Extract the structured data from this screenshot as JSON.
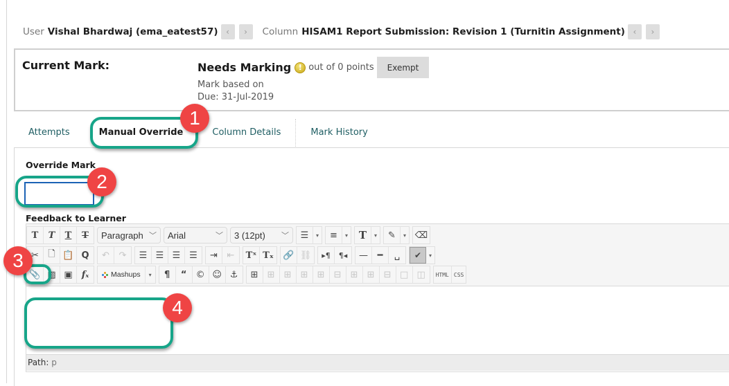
{
  "header": {
    "user_label": "User",
    "user_value": "Vishal Bhardwaj (ema_eatest57)",
    "column_label": "Column",
    "column_value": "HISAM1 Report Submission: Revision 1 (Turnitin Assignment)",
    "prev_icon": "‹",
    "next_icon": "›"
  },
  "current_mark": {
    "title": "Current Mark:",
    "status": "Needs Marking",
    "status_icon": "!",
    "out_of": "out of 0 points",
    "exempt_label": "Exempt",
    "based_on": "Mark based on",
    "due": "Due: 31-Jul-2019"
  },
  "tabs": [
    {
      "label": "Attempts",
      "active": false
    },
    {
      "label": "Manual Override",
      "active": true
    },
    {
      "label": "Column Details",
      "active": false
    },
    {
      "label": "Mark History",
      "active": false
    }
  ],
  "override": {
    "label": "Override Mark",
    "value": ""
  },
  "feedback": {
    "label": "Feedback to Learner",
    "paragraph_select": "Paragraph",
    "font_select": "Arial",
    "size_select": "3 (12pt)",
    "mashups_label": "Mashups",
    "html_label": "HTML",
    "css_label": "CSS",
    "path_label": "Path:",
    "path_value": "p",
    "body_text": ""
  },
  "annotations": [
    "1",
    "2",
    "3",
    "4"
  ],
  "colors": {
    "highlight": "#17a589",
    "badge": "#ef4444",
    "tab_link": "#1f5e63",
    "input_focus": "#1b63b5"
  }
}
